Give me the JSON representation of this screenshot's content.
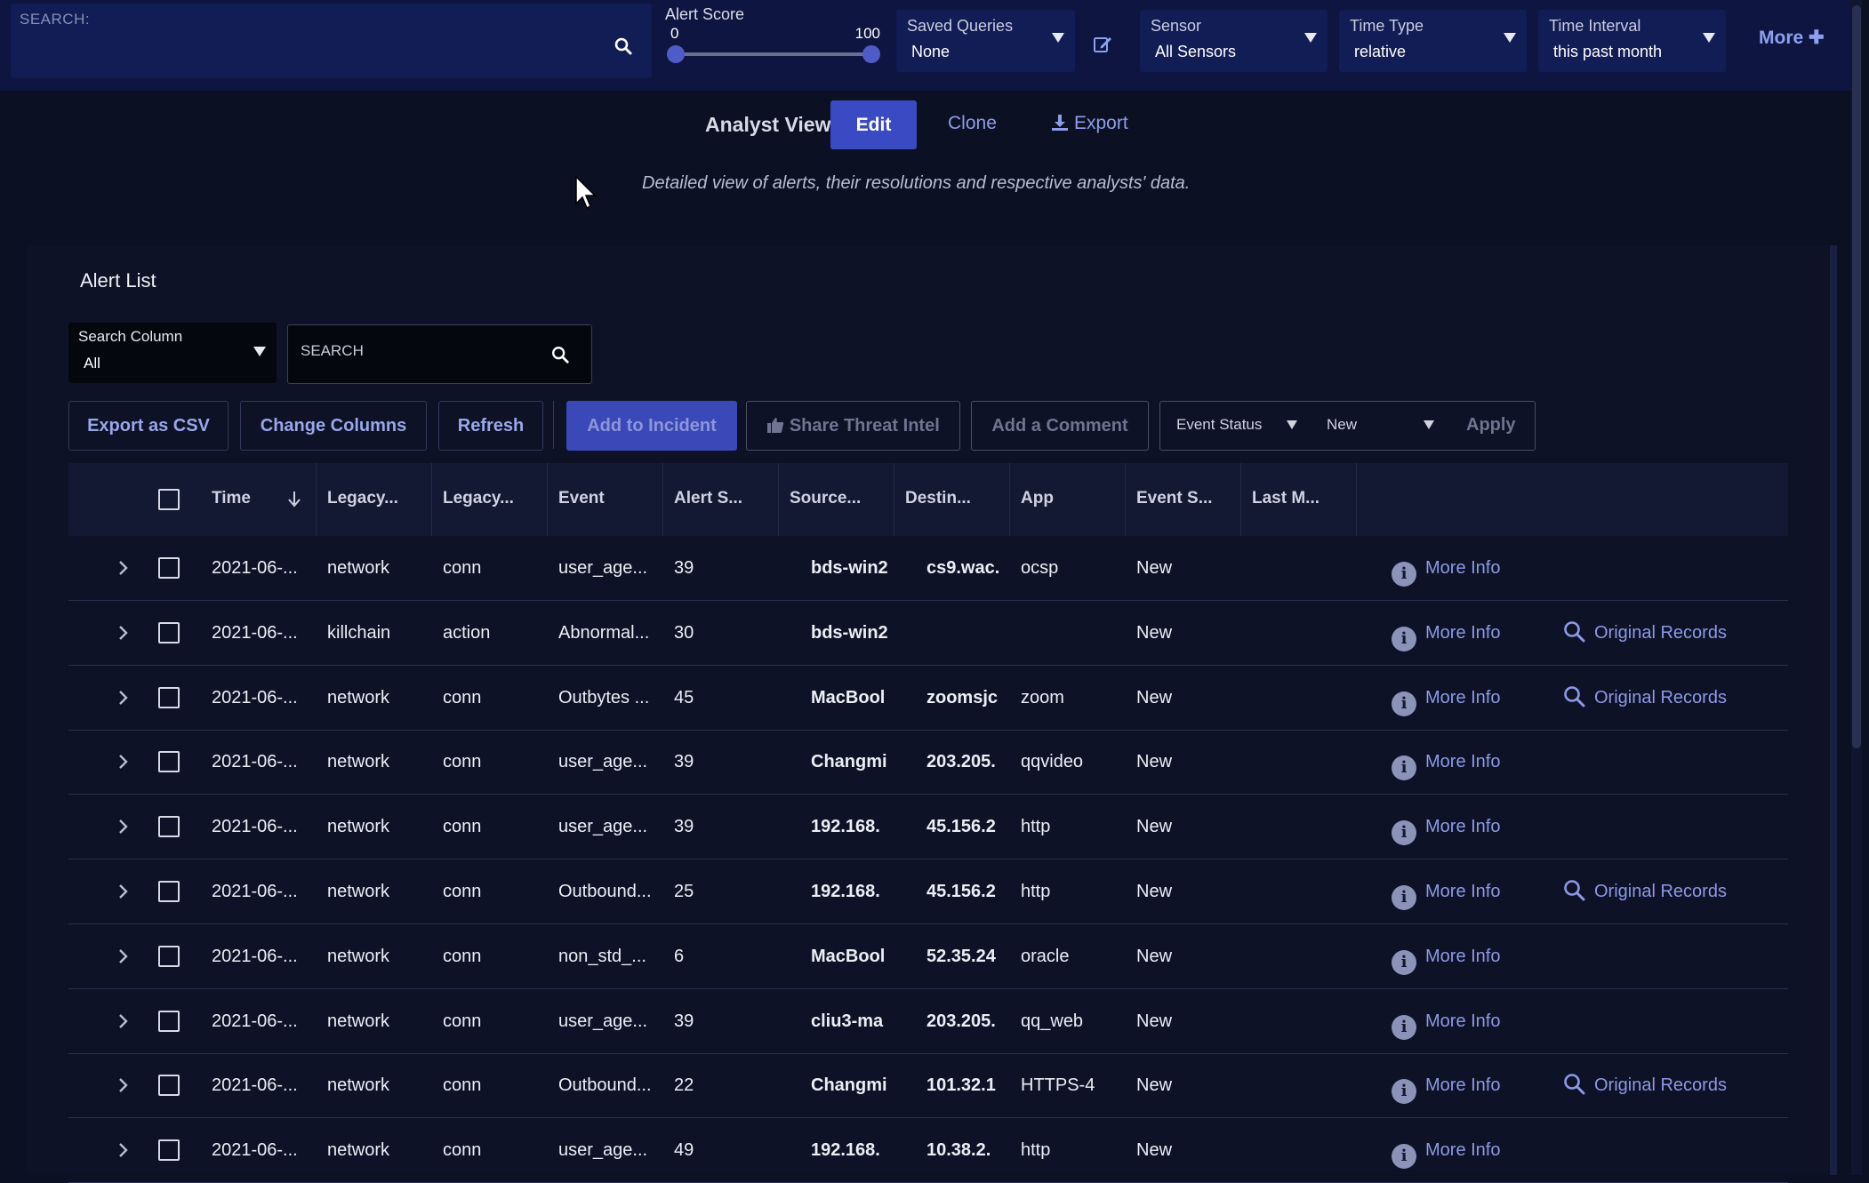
{
  "topbar": {
    "search_label": "SEARCH:",
    "alert_score": {
      "title": "Alert Score",
      "min": "0",
      "max": "100"
    },
    "saved_queries": {
      "label": "Saved Queries",
      "value": "None"
    },
    "sensor": {
      "label": "Sensor",
      "value": "All Sensors"
    },
    "time_type": {
      "label": "Time Type",
      "value": "relative"
    },
    "time_interval": {
      "label": "Time Interval",
      "value": "this past month"
    },
    "more_label": "More ✚"
  },
  "view": {
    "title": "Analyst View",
    "edit_label": "Edit",
    "clone_label": "Clone",
    "export_label": "Export",
    "description": "Detailed view of alerts, their resolutions and respective analysts' data."
  },
  "alert_list": {
    "title": "Alert List",
    "search_column": {
      "label": "Search Column",
      "value": "All"
    },
    "search_placeholder": "SEARCH",
    "toolbar": {
      "export_csv": "Export as CSV",
      "change_columns": "Change Columns",
      "refresh": "Refresh",
      "add_incident": "Add to Incident",
      "share_intel": "Share Threat Intel",
      "add_comment": "Add a Comment",
      "event_status_label": "Event Status",
      "event_status_value": "New",
      "apply": "Apply"
    },
    "columns": [
      "Time",
      "Legacy...",
      "Legacy...",
      "Event",
      "Alert S...",
      "Source...",
      "Destin...",
      "App",
      "Event S...",
      "Last M..."
    ],
    "more_info_label": "More Info",
    "original_records_label": "Original Records",
    "rows": [
      {
        "time": "2021-06-...",
        "legacy1": "network",
        "legacy2": "conn",
        "event": "user_age...",
        "score": "39",
        "source": "bds-win2",
        "dest": "cs9.wac.",
        "app": "ocsp",
        "status": "New",
        "original": false
      },
      {
        "time": "2021-06-...",
        "legacy1": "killchain",
        "legacy2": "action",
        "event": "Abnormal...",
        "score": "30",
        "source": "bds-win2",
        "dest": "",
        "app": "",
        "status": "New",
        "original": true
      },
      {
        "time": "2021-06-...",
        "legacy1": "network",
        "legacy2": "conn",
        "event": "Outbytes ...",
        "score": "45",
        "source": "MacBool",
        "dest": "zoomsjc",
        "app": "zoom",
        "status": "New",
        "original": true
      },
      {
        "time": "2021-06-...",
        "legacy1": "network",
        "legacy2": "conn",
        "event": "user_age...",
        "score": "39",
        "source": "Changmi",
        "dest": "203.205.",
        "app": "qqvideo",
        "status": "New",
        "original": false
      },
      {
        "time": "2021-06-...",
        "legacy1": "network",
        "legacy2": "conn",
        "event": "user_age...",
        "score": "39",
        "source": "192.168.",
        "dest": "45.156.2",
        "app": "http",
        "status": "New",
        "original": false
      },
      {
        "time": "2021-06-...",
        "legacy1": "network",
        "legacy2": "conn",
        "event": "Outbound...",
        "score": "25",
        "source": "192.168.",
        "dest": "45.156.2",
        "app": "http",
        "status": "New",
        "original": true
      },
      {
        "time": "2021-06-...",
        "legacy1": "network",
        "legacy2": "conn",
        "event": "non_std_...",
        "score": "6",
        "source": "MacBool",
        "dest": "52.35.24",
        "app": "oracle",
        "status": "New",
        "original": false
      },
      {
        "time": "2021-06-...",
        "legacy1": "network",
        "legacy2": "conn",
        "event": "user_age...",
        "score": "39",
        "source": "cliu3-ma",
        "dest": "203.205.",
        "app": "qq_web",
        "status": "New",
        "original": false
      },
      {
        "time": "2021-06-...",
        "legacy1": "network",
        "legacy2": "conn",
        "event": "Outbound...",
        "score": "22",
        "source": "Changmi",
        "dest": "101.32.1",
        "app": "HTTPS-4",
        "status": "New",
        "original": true
      },
      {
        "time": "2021-06-...",
        "legacy1": "network",
        "legacy2": "conn",
        "event": "user_age...",
        "score": "49",
        "source": "192.168.",
        "dest": "10.38.2.",
        "app": "http",
        "status": "New",
        "original": false
      }
    ]
  }
}
